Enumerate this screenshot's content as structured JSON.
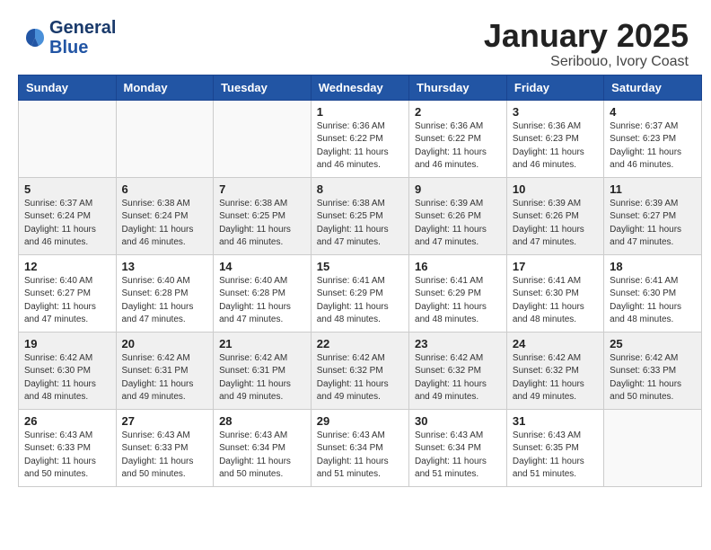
{
  "header": {
    "logo_line1": "General",
    "logo_line2": "Blue",
    "month": "January 2025",
    "location": "Seribouo, Ivory Coast"
  },
  "weekdays": [
    "Sunday",
    "Monday",
    "Tuesday",
    "Wednesday",
    "Thursday",
    "Friday",
    "Saturday"
  ],
  "weeks": [
    [
      {
        "day": "",
        "info": ""
      },
      {
        "day": "",
        "info": ""
      },
      {
        "day": "",
        "info": ""
      },
      {
        "day": "1",
        "info": "Sunrise: 6:36 AM\nSunset: 6:22 PM\nDaylight: 11 hours\nand 46 minutes."
      },
      {
        "day": "2",
        "info": "Sunrise: 6:36 AM\nSunset: 6:22 PM\nDaylight: 11 hours\nand 46 minutes."
      },
      {
        "day": "3",
        "info": "Sunrise: 6:36 AM\nSunset: 6:23 PM\nDaylight: 11 hours\nand 46 minutes."
      },
      {
        "day": "4",
        "info": "Sunrise: 6:37 AM\nSunset: 6:23 PM\nDaylight: 11 hours\nand 46 minutes."
      }
    ],
    [
      {
        "day": "5",
        "info": "Sunrise: 6:37 AM\nSunset: 6:24 PM\nDaylight: 11 hours\nand 46 minutes."
      },
      {
        "day": "6",
        "info": "Sunrise: 6:38 AM\nSunset: 6:24 PM\nDaylight: 11 hours\nand 46 minutes."
      },
      {
        "day": "7",
        "info": "Sunrise: 6:38 AM\nSunset: 6:25 PM\nDaylight: 11 hours\nand 46 minutes."
      },
      {
        "day": "8",
        "info": "Sunrise: 6:38 AM\nSunset: 6:25 PM\nDaylight: 11 hours\nand 47 minutes."
      },
      {
        "day": "9",
        "info": "Sunrise: 6:39 AM\nSunset: 6:26 PM\nDaylight: 11 hours\nand 47 minutes."
      },
      {
        "day": "10",
        "info": "Sunrise: 6:39 AM\nSunset: 6:26 PM\nDaylight: 11 hours\nand 47 minutes."
      },
      {
        "day": "11",
        "info": "Sunrise: 6:39 AM\nSunset: 6:27 PM\nDaylight: 11 hours\nand 47 minutes."
      }
    ],
    [
      {
        "day": "12",
        "info": "Sunrise: 6:40 AM\nSunset: 6:27 PM\nDaylight: 11 hours\nand 47 minutes."
      },
      {
        "day": "13",
        "info": "Sunrise: 6:40 AM\nSunset: 6:28 PM\nDaylight: 11 hours\nand 47 minutes."
      },
      {
        "day": "14",
        "info": "Sunrise: 6:40 AM\nSunset: 6:28 PM\nDaylight: 11 hours\nand 47 minutes."
      },
      {
        "day": "15",
        "info": "Sunrise: 6:41 AM\nSunset: 6:29 PM\nDaylight: 11 hours\nand 48 minutes."
      },
      {
        "day": "16",
        "info": "Sunrise: 6:41 AM\nSunset: 6:29 PM\nDaylight: 11 hours\nand 48 minutes."
      },
      {
        "day": "17",
        "info": "Sunrise: 6:41 AM\nSunset: 6:30 PM\nDaylight: 11 hours\nand 48 minutes."
      },
      {
        "day": "18",
        "info": "Sunrise: 6:41 AM\nSunset: 6:30 PM\nDaylight: 11 hours\nand 48 minutes."
      }
    ],
    [
      {
        "day": "19",
        "info": "Sunrise: 6:42 AM\nSunset: 6:30 PM\nDaylight: 11 hours\nand 48 minutes."
      },
      {
        "day": "20",
        "info": "Sunrise: 6:42 AM\nSunset: 6:31 PM\nDaylight: 11 hours\nand 49 minutes."
      },
      {
        "day": "21",
        "info": "Sunrise: 6:42 AM\nSunset: 6:31 PM\nDaylight: 11 hours\nand 49 minutes."
      },
      {
        "day": "22",
        "info": "Sunrise: 6:42 AM\nSunset: 6:32 PM\nDaylight: 11 hours\nand 49 minutes."
      },
      {
        "day": "23",
        "info": "Sunrise: 6:42 AM\nSunset: 6:32 PM\nDaylight: 11 hours\nand 49 minutes."
      },
      {
        "day": "24",
        "info": "Sunrise: 6:42 AM\nSunset: 6:32 PM\nDaylight: 11 hours\nand 49 minutes."
      },
      {
        "day": "25",
        "info": "Sunrise: 6:42 AM\nSunset: 6:33 PM\nDaylight: 11 hours\nand 50 minutes."
      }
    ],
    [
      {
        "day": "26",
        "info": "Sunrise: 6:43 AM\nSunset: 6:33 PM\nDaylight: 11 hours\nand 50 minutes."
      },
      {
        "day": "27",
        "info": "Sunrise: 6:43 AM\nSunset: 6:33 PM\nDaylight: 11 hours\nand 50 minutes."
      },
      {
        "day": "28",
        "info": "Sunrise: 6:43 AM\nSunset: 6:34 PM\nDaylight: 11 hours\nand 50 minutes."
      },
      {
        "day": "29",
        "info": "Sunrise: 6:43 AM\nSunset: 6:34 PM\nDaylight: 11 hours\nand 51 minutes."
      },
      {
        "day": "30",
        "info": "Sunrise: 6:43 AM\nSunset: 6:34 PM\nDaylight: 11 hours\nand 51 minutes."
      },
      {
        "day": "31",
        "info": "Sunrise: 6:43 AM\nSunset: 6:35 PM\nDaylight: 11 hours\nand 51 minutes."
      },
      {
        "day": "",
        "info": ""
      }
    ]
  ]
}
